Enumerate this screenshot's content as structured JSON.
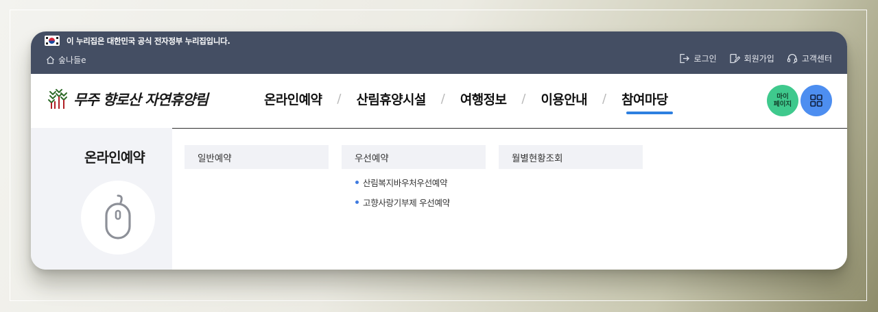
{
  "gov_banner": {
    "text": "이 누리집은 대한민국 공식 전자정부 누리집입니다."
  },
  "home": {
    "label": "숲나들e"
  },
  "util_links": [
    {
      "label": "로그인",
      "icon": "login-icon"
    },
    {
      "label": "회원가입",
      "icon": "signup-icon"
    },
    {
      "label": "고객센터",
      "icon": "headset-icon"
    }
  ],
  "logo": {
    "text": "무주 향로산 자연휴양림"
  },
  "gnb": [
    {
      "label": "온라인예약"
    },
    {
      "label": "산림휴양시설"
    },
    {
      "label": "여행정보"
    },
    {
      "label": "이용안내"
    },
    {
      "label": "참여마당",
      "active": true
    }
  ],
  "mypage": {
    "line1": "마이",
    "line2": "페이지"
  },
  "submenu": {
    "title": "온라인예약",
    "columns": [
      {
        "label": "일반예약",
        "items": []
      },
      {
        "label": "우선예약",
        "items": [
          {
            "label": "산림복지바우처우선예약"
          },
          {
            "label": "고향사랑기부제 우선예약"
          }
        ]
      },
      {
        "label": "월별현황조회",
        "items": []
      }
    ]
  },
  "colors": {
    "topbar": "#444e63",
    "accent": "#2d7fe0",
    "mypage": "#3fc98d",
    "allmenu": "#4d8ef0"
  }
}
